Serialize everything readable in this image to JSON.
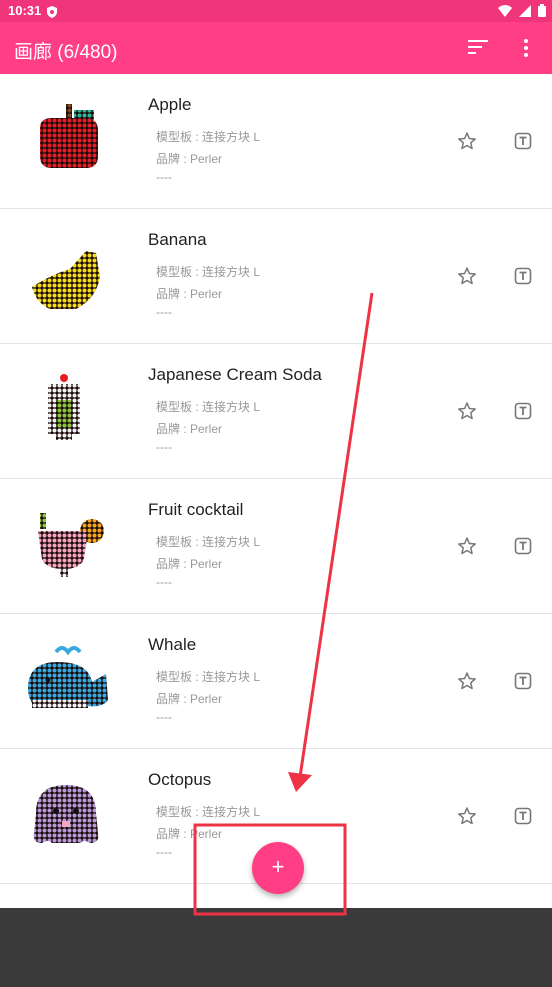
{
  "status_bar": {
    "time": "10:31"
  },
  "app_bar": {
    "title": "画廊 (6/480)"
  },
  "items": [
    {
      "name": "Apple",
      "template": "模型板 : 连接方块 L",
      "brand": "品牌 : Perler",
      "note": "----"
    },
    {
      "name": "Banana",
      "template": "模型板 : 连接方块 L",
      "brand": "品牌 : Perler",
      "note": "----"
    },
    {
      "name": "Japanese Cream Soda",
      "template": "模型板 : 连接方块 L",
      "brand": "品牌 : Perler",
      "note": "----"
    },
    {
      "name": "Fruit cocktail",
      "template": "模型板 : 连接方块 L",
      "brand": "品牌 : Perler",
      "note": "----"
    },
    {
      "name": "Whale",
      "template": "模型板 : 连接方块 L",
      "brand": "品牌 : Perler",
      "note": "----"
    },
    {
      "name": "Octopus",
      "template": "模型板 : 连接方块 L",
      "brand": "品牌 : Perler",
      "note": "----"
    }
  ],
  "fab": {
    "label": "+"
  },
  "colors": {
    "accent": "#ff3e85",
    "status_bar": "#f0357b",
    "annotation": "#ee3344"
  },
  "icons": [
    "shield-icon",
    "wifi-icon",
    "signal-icon",
    "battery-icon",
    "sort-icon",
    "more-vert-icon",
    "star-outline-icon",
    "text-icon",
    "add-icon"
  ]
}
